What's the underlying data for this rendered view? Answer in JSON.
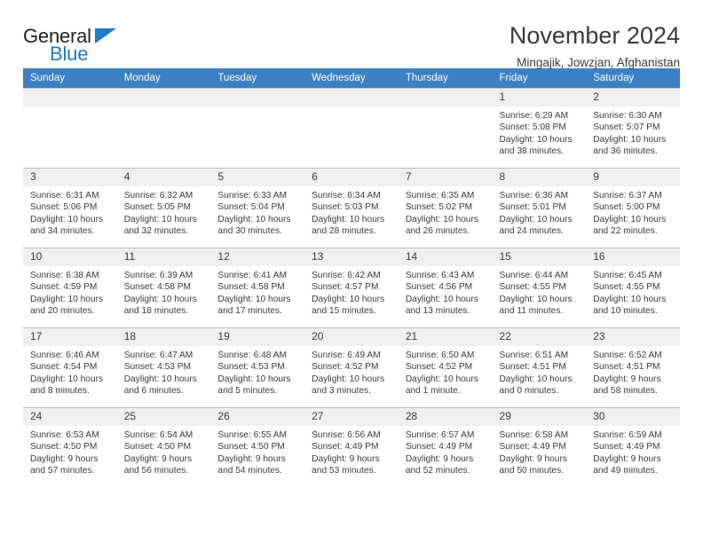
{
  "brand": {
    "name_top": "General",
    "name_bottom": "Blue",
    "accent_color": "#1f7ac4"
  },
  "header": {
    "title": "November 2024",
    "subtitle": "Mingajik, Jowzjan, Afghanistan"
  },
  "theme": {
    "header_row_bg": "#3b80c4",
    "daynum_bg": "#efefef",
    "grid_line": "#b9b9b9"
  },
  "weekday_headers": [
    "Sunday",
    "Monday",
    "Tuesday",
    "Wednesday",
    "Thursday",
    "Friday",
    "Saturday"
  ],
  "weeks": [
    [
      {
        "day": ""
      },
      {
        "day": ""
      },
      {
        "day": ""
      },
      {
        "day": ""
      },
      {
        "day": ""
      },
      {
        "day": "1",
        "sunrise": "Sunrise: 6:29 AM",
        "sunset": "Sunset: 5:08 PM",
        "daylight": "Daylight: 10 hours and 38 minutes."
      },
      {
        "day": "2",
        "sunrise": "Sunrise: 6:30 AM",
        "sunset": "Sunset: 5:07 PM",
        "daylight": "Daylight: 10 hours and 36 minutes."
      }
    ],
    [
      {
        "day": "3",
        "sunrise": "Sunrise: 6:31 AM",
        "sunset": "Sunset: 5:06 PM",
        "daylight": "Daylight: 10 hours and 34 minutes."
      },
      {
        "day": "4",
        "sunrise": "Sunrise: 6:32 AM",
        "sunset": "Sunset: 5:05 PM",
        "daylight": "Daylight: 10 hours and 32 minutes."
      },
      {
        "day": "5",
        "sunrise": "Sunrise: 6:33 AM",
        "sunset": "Sunset: 5:04 PM",
        "daylight": "Daylight: 10 hours and 30 minutes."
      },
      {
        "day": "6",
        "sunrise": "Sunrise: 6:34 AM",
        "sunset": "Sunset: 5:03 PM",
        "daylight": "Daylight: 10 hours and 28 minutes."
      },
      {
        "day": "7",
        "sunrise": "Sunrise: 6:35 AM",
        "sunset": "Sunset: 5:02 PM",
        "daylight": "Daylight: 10 hours and 26 minutes."
      },
      {
        "day": "8",
        "sunrise": "Sunrise: 6:36 AM",
        "sunset": "Sunset: 5:01 PM",
        "daylight": "Daylight: 10 hours and 24 minutes."
      },
      {
        "day": "9",
        "sunrise": "Sunrise: 6:37 AM",
        "sunset": "Sunset: 5:00 PM",
        "daylight": "Daylight: 10 hours and 22 minutes."
      }
    ],
    [
      {
        "day": "10",
        "sunrise": "Sunrise: 6:38 AM",
        "sunset": "Sunset: 4:59 PM",
        "daylight": "Daylight: 10 hours and 20 minutes."
      },
      {
        "day": "11",
        "sunrise": "Sunrise: 6:39 AM",
        "sunset": "Sunset: 4:58 PM",
        "daylight": "Daylight: 10 hours and 18 minutes."
      },
      {
        "day": "12",
        "sunrise": "Sunrise: 6:41 AM",
        "sunset": "Sunset: 4:58 PM",
        "daylight": "Daylight: 10 hours and 17 minutes."
      },
      {
        "day": "13",
        "sunrise": "Sunrise: 6:42 AM",
        "sunset": "Sunset: 4:57 PM",
        "daylight": "Daylight: 10 hours and 15 minutes."
      },
      {
        "day": "14",
        "sunrise": "Sunrise: 6:43 AM",
        "sunset": "Sunset: 4:56 PM",
        "daylight": "Daylight: 10 hours and 13 minutes."
      },
      {
        "day": "15",
        "sunrise": "Sunrise: 6:44 AM",
        "sunset": "Sunset: 4:55 PM",
        "daylight": "Daylight: 10 hours and 11 minutes."
      },
      {
        "day": "16",
        "sunrise": "Sunrise: 6:45 AM",
        "sunset": "Sunset: 4:55 PM",
        "daylight": "Daylight: 10 hours and 10 minutes."
      }
    ],
    [
      {
        "day": "17",
        "sunrise": "Sunrise: 6:46 AM",
        "sunset": "Sunset: 4:54 PM",
        "daylight": "Daylight: 10 hours and 8 minutes."
      },
      {
        "day": "18",
        "sunrise": "Sunrise: 6:47 AM",
        "sunset": "Sunset: 4:53 PM",
        "daylight": "Daylight: 10 hours and 6 minutes."
      },
      {
        "day": "19",
        "sunrise": "Sunrise: 6:48 AM",
        "sunset": "Sunset: 4:53 PM",
        "daylight": "Daylight: 10 hours and 5 minutes."
      },
      {
        "day": "20",
        "sunrise": "Sunrise: 6:49 AM",
        "sunset": "Sunset: 4:52 PM",
        "daylight": "Daylight: 10 hours and 3 minutes."
      },
      {
        "day": "21",
        "sunrise": "Sunrise: 6:50 AM",
        "sunset": "Sunset: 4:52 PM",
        "daylight": "Daylight: 10 hours and 1 minute."
      },
      {
        "day": "22",
        "sunrise": "Sunrise: 6:51 AM",
        "sunset": "Sunset: 4:51 PM",
        "daylight": "Daylight: 10 hours and 0 minutes."
      },
      {
        "day": "23",
        "sunrise": "Sunrise: 6:52 AM",
        "sunset": "Sunset: 4:51 PM",
        "daylight": "Daylight: 9 hours and 58 minutes."
      }
    ],
    [
      {
        "day": "24",
        "sunrise": "Sunrise: 6:53 AM",
        "sunset": "Sunset: 4:50 PM",
        "daylight": "Daylight: 9 hours and 57 minutes."
      },
      {
        "day": "25",
        "sunrise": "Sunrise: 6:54 AM",
        "sunset": "Sunset: 4:50 PM",
        "daylight": "Daylight: 9 hours and 56 minutes."
      },
      {
        "day": "26",
        "sunrise": "Sunrise: 6:55 AM",
        "sunset": "Sunset: 4:50 PM",
        "daylight": "Daylight: 9 hours and 54 minutes."
      },
      {
        "day": "27",
        "sunrise": "Sunrise: 6:56 AM",
        "sunset": "Sunset: 4:49 PM",
        "daylight": "Daylight: 9 hours and 53 minutes."
      },
      {
        "day": "28",
        "sunrise": "Sunrise: 6:57 AM",
        "sunset": "Sunset: 4:49 PM",
        "daylight": "Daylight: 9 hours and 52 minutes."
      },
      {
        "day": "29",
        "sunrise": "Sunrise: 6:58 AM",
        "sunset": "Sunset: 4:49 PM",
        "daylight": "Daylight: 9 hours and 50 minutes."
      },
      {
        "day": "30",
        "sunrise": "Sunrise: 6:59 AM",
        "sunset": "Sunset: 4:49 PM",
        "daylight": "Daylight: 9 hours and 49 minutes."
      }
    ]
  ]
}
